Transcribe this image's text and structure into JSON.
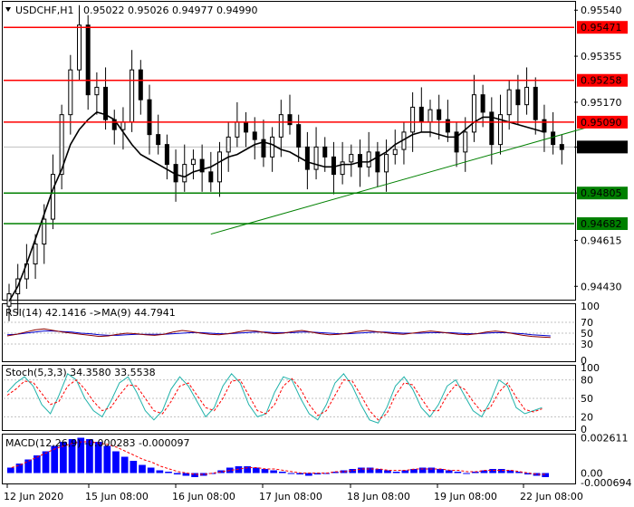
{
  "header": {
    "symbol": "USDCHF,H1",
    "ohlc": "0.95022 0.95026 0.94977 0.94990"
  },
  "rsi_header": "RSI(14) 42.1416  ->MA(9) 44.7941",
  "stoch_header": "Stoch(5,3,3) 34.3580 33.5538",
  "macd_header": "MACD(12,26,9) -0.000283 -0.000097",
  "colors": {
    "bull": "#000000",
    "bear": "#000000",
    "resistance": "#ff0000",
    "support": "#008000",
    "trendline": "#008000",
    "ma": "#000000",
    "rsi": "#8b0000",
    "rsi_ma": "#0000cd",
    "stoch_main": "#20b2aa",
    "stoch_signal": "#ff0000",
    "macd_hist": "#0000ff",
    "macd_signal": "#ff0000"
  },
  "chart_data": [
    {
      "type": "candlestick",
      "title": "USDCHF,H1",
      "ylim": [
        0.9438,
        0.9557
      ],
      "y_ticks": [
        "0.95540",
        "0.95355",
        "0.95170",
        "0.94990",
        "0.94805",
        "0.94615",
        "0.94430"
      ],
      "x_ticks": [
        "12 Jun 2020",
        "15 Jun 08:00",
        "16 Jun 08:00",
        "17 Jun 08:00",
        "18 Jun 08:00",
        "19 Jun 08:00",
        "22 Jun 08:00"
      ],
      "levels": [
        {
          "name": "resistance",
          "value": 0.95471,
          "label": "0.95471"
        },
        {
          "name": "resistance",
          "value": 0.95258,
          "label": "0.95258"
        },
        {
          "name": "resistance",
          "value": 0.9509,
          "label": "0.95090"
        },
        {
          "name": "support",
          "value": 0.94805,
          "label": "0.94805"
        },
        {
          "name": "support",
          "value": 0.94682,
          "label": "0.94682"
        }
      ],
      "current_price": {
        "value": 0.9499,
        "label": "0.94990"
      },
      "trendline": {
        "from": [
          23,
          0.9464
        ],
        "to": [
          69,
          0.951
        ]
      },
      "closes": [
        0.944,
        0.9446,
        0.9452,
        0.946,
        0.947,
        0.9488,
        0.9512,
        0.953,
        0.9548,
        0.952,
        0.9523,
        0.951,
        0.9506,
        0.9509,
        0.953,
        0.9518,
        0.9504,
        0.95,
        0.9492,
        0.9485,
        0.9492,
        0.9494,
        0.9489,
        0.9485,
        0.9497,
        0.9503,
        0.9509,
        0.9505,
        0.9502,
        0.9495,
        0.9503,
        0.9512,
        0.9508,
        0.9499,
        0.949,
        0.9499,
        0.9495,
        0.9488,
        0.9493,
        0.9496,
        0.9491,
        0.9497,
        0.9489,
        0.9496,
        0.9498,
        0.9505,
        0.9515,
        0.9509,
        0.9514,
        0.951,
        0.9505,
        0.9497,
        0.9505,
        0.952,
        0.9513,
        0.95,
        0.9512,
        0.9522,
        0.9516,
        0.9523,
        0.951,
        0.9505,
        0.95,
        0.9498
      ],
      "ma_values": [
        0.9437,
        0.9443,
        0.9452,
        0.9462,
        0.9472,
        0.9482,
        0.949,
        0.95,
        0.9506,
        0.951,
        0.9513,
        0.9512,
        0.951,
        0.9505,
        0.95,
        0.9496,
        0.9494,
        0.9492,
        0.949,
        0.9488,
        0.9487,
        0.9489,
        0.949,
        0.9491,
        0.9493,
        0.9495,
        0.9496,
        0.9498,
        0.95,
        0.9501,
        0.95,
        0.9498,
        0.9497,
        0.9495,
        0.9493,
        0.9492,
        0.9491,
        0.9491,
        0.9492,
        0.9492,
        0.9493,
        0.9493,
        0.9495,
        0.9497,
        0.95,
        0.9502,
        0.9504,
        0.9505,
        0.9505,
        0.9504,
        0.9503,
        0.9503,
        0.9506,
        0.9509,
        0.9511,
        0.9511,
        0.951,
        0.9509,
        0.9508,
        0.9507,
        0.9506,
        0.9505
      ]
    },
    {
      "type": "line",
      "title": "RSI(14)",
      "ylim": [
        0,
        100
      ],
      "y_ticks": [
        "100",
        "70",
        "50",
        "30",
        "0"
      ],
      "series": [
        {
          "name": "RSI(14)",
          "values": [
            45,
            48,
            52,
            56,
            58,
            55,
            52,
            50,
            48,
            46,
            44,
            45,
            48,
            50,
            49,
            47,
            46,
            48,
            52,
            55,
            53,
            50,
            48,
            47,
            49,
            52,
            55,
            54,
            51,
            49,
            50,
            53,
            55,
            52,
            49,
            47,
            48,
            50,
            53,
            55,
            53,
            51,
            49,
            48,
            50,
            52,
            54,
            52,
            50,
            48,
            47,
            49,
            52,
            54,
            52,
            49,
            46,
            44,
            43,
            42
          ]
        },
        {
          "name": "MA(9)",
          "values": [
            47,
            48,
            50,
            52,
            54,
            54,
            53,
            52,
            50,
            49,
            47,
            46,
            46,
            47,
            48,
            48,
            48,
            48,
            49,
            50,
            51,
            51,
            50,
            49,
            49,
            50,
            51,
            52,
            52,
            51,
            51,
            51,
            52,
            52,
            51,
            50,
            49,
            49,
            50,
            51,
            52,
            52,
            51,
            50,
            50,
            50,
            51,
            51,
            51,
            50,
            49,
            49,
            50,
            51,
            51,
            50,
            49,
            47,
            46,
            45
          ]
        }
      ]
    },
    {
      "type": "line",
      "title": "Stoch(5,3,3)",
      "ylim": [
        0,
        100
      ],
      "y_ticks": [
        "100",
        "80",
        "50",
        "20",
        "0"
      ],
      "series": [
        {
          "name": "%K",
          "values": [
            60,
            75,
            85,
            70,
            40,
            25,
            55,
            90,
            80,
            50,
            30,
            20,
            45,
            75,
            85,
            60,
            30,
            15,
            30,
            65,
            85,
            70,
            45,
            20,
            35,
            70,
            90,
            75,
            40,
            20,
            25,
            60,
            85,
            80,
            50,
            25,
            15,
            40,
            75,
            90,
            70,
            40,
            15,
            10,
            35,
            70,
            85,
            65,
            35,
            20,
            40,
            70,
            80,
            55,
            30,
            20,
            45,
            80,
            70,
            35,
            25,
            30,
            35
          ]
        },
        {
          "name": "%D",
          "values": [
            55,
            65,
            78,
            76,
            58,
            40,
            45,
            70,
            80,
            65,
            45,
            30,
            35,
            55,
            72,
            70,
            50,
            30,
            25,
            45,
            70,
            75,
            55,
            35,
            30,
            50,
            78,
            80,
            55,
            30,
            25,
            40,
            70,
            82,
            65,
            40,
            22,
            30,
            55,
            80,
            78,
            55,
            30,
            15,
            25,
            55,
            75,
            72,
            50,
            30,
            30,
            55,
            72,
            65,
            45,
            28,
            35,
            60,
            75,
            52,
            32,
            28,
            33
          ]
        }
      ]
    },
    {
      "type": "bar",
      "title": "MACD(12,26,9)",
      "y_ticks": [
        "0.002611",
        "0.00",
        "-0.000694"
      ],
      "histogram": [
        0.0004,
        0.0007,
        0.001,
        0.0013,
        0.0016,
        0.002,
        0.0023,
        0.0025,
        0.0026,
        0.0025,
        0.0023,
        0.002,
        0.0016,
        0.0012,
        0.0009,
        0.0006,
        0.0004,
        0.0002,
        0.0001,
        -0.0001,
        -0.0002,
        -0.0003,
        -0.0002,
        0.0,
        0.0002,
        0.0004,
        0.0005,
        0.0005,
        0.0004,
        0.0003,
        0.0002,
        0.0001,
        0.0,
        -0.0001,
        -0.0002,
        -0.0001,
        0.0,
        0.0001,
        0.0002,
        0.0003,
        0.0004,
        0.0004,
        0.0003,
        0.0002,
        0.0001,
        0.0002,
        0.0003,
        0.0004,
        0.0004,
        0.0003,
        0.0002,
        0.0001,
        0.0,
        0.0001,
        0.0002,
        0.0003,
        0.0003,
        0.0002,
        0.0001,
        -0.0001,
        -0.0002,
        -0.0003
      ],
      "signal": [
        0.0004,
        0.0006,
        0.0009,
        0.0012,
        0.0015,
        0.0018,
        0.002,
        0.0022,
        0.0023,
        0.0023,
        0.0022,
        0.0021,
        0.0019,
        0.0016,
        0.0013,
        0.001,
        0.0008,
        0.0005,
        0.0003,
        0.0001,
        0.0,
        -0.0001,
        -0.0001,
        0.0,
        0.0001,
        0.0002,
        0.0003,
        0.0004,
        0.0004,
        0.0003,
        0.0003,
        0.0002,
        0.0001,
        0.0,
        0.0,
        0.0,
        0.0,
        0.0001,
        0.0001,
        0.0002,
        0.0003,
        0.0003,
        0.0003,
        0.0002,
        0.0002,
        0.0002,
        0.0003,
        0.0003,
        0.0003,
        0.0003,
        0.0002,
        0.0002,
        0.0001,
        0.0001,
        0.0002,
        0.0002,
        0.0002,
        0.0002,
        0.0001,
        0.0,
        -0.0001,
        -0.0001
      ]
    }
  ]
}
